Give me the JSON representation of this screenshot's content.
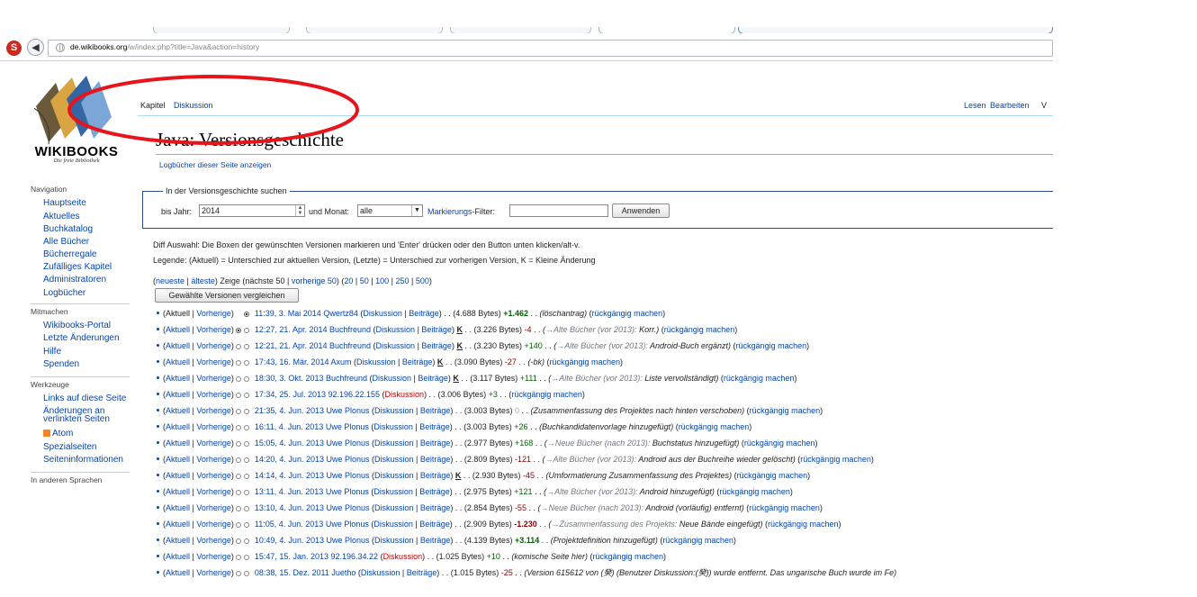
{
  "browser": {
    "url_domain": "de.wikibooks.org",
    "url_path": "/w/index.php?title=Java&action=history"
  },
  "logo": {
    "name": "WIKIBOOKS",
    "tagline": "Die freie Bibliothek"
  },
  "tabs": {
    "left": [
      "Kapitel",
      "Diskussion"
    ],
    "right": [
      "Lesen",
      "Bearbeiten",
      "V"
    ]
  },
  "page": {
    "title": "Java: Versionsgeschichte",
    "log_link": "Logbücher dieser Seite anzeigen"
  },
  "nav": {
    "navigation_title": "Navigation",
    "navigation_items": [
      "Hauptseite",
      "Aktuelles",
      "Buchkatalog",
      "Alle Bücher",
      "Bücherregale",
      "Zufälliges Kapitel",
      "Administratoren",
      "Logbücher"
    ],
    "mitmachen_title": "Mitmachen",
    "mitmachen_items": [
      "Wikibooks-Portal",
      "Letzte Änderungen",
      "Hilfe",
      "Spenden"
    ],
    "werkzeuge_title": "Werkzeuge",
    "werkzeuge_items": [
      "Links auf diese Seite",
      "Änderungen an",
      "verlinkten Seiten",
      "Atom",
      "Spezialseiten",
      "Seiteninformationen"
    ],
    "languages_title": "In anderen Sprachen"
  },
  "search": {
    "legend": "In der Versionsgeschichte suchen",
    "year_label": "bis Jahr:",
    "year_value": "2014",
    "month_label": "und Monat:",
    "month_value": "alle",
    "filter_label": "Markierungs",
    "filter_suffix": "-Filter:",
    "apply_button": "Anwenden"
  },
  "info": {
    "diff_help": "Diff Auswahl: Die Boxen der gewünschten Versionen markieren und 'Enter' drücken oder den Button unten klicken/alt-v.",
    "legend": "Legende: (Aktuell) = Unterschied zur aktuellen Version, (Letzte) = Unterschied zur vorherigen Version, K = Kleine Änderung"
  },
  "paging": {
    "newest": "neueste",
    "oldest": "älteste",
    "show": "Zeige (nächste 50 |",
    "prev50": "vorherige 50",
    "sizes": [
      "20",
      "50",
      "100",
      "250",
      "500"
    ],
    "compare_button": "Gewählte Versionen vergleichen"
  },
  "labels": {
    "current": "Aktuell",
    "previous": "Vorherige",
    "talk": "Diskussion",
    "contribs": "Beiträge",
    "undo": "rückgängig machen",
    "minor": "K"
  },
  "revisions": [
    {
      "ts": "11:39, 3. Mai 2014",
      "user": "Qwertz84",
      "ip": false,
      "minor": false,
      "size": "4.688 Bytes",
      "diff": "+1.462",
      "diff_class": "pos b",
      "section": "",
      "summary": "löschantrag",
      "radio1": "gap",
      "radio2": "on",
      "current_link": false
    },
    {
      "ts": "12:27, 21. Apr. 2014",
      "user": "Buchfreund",
      "ip": false,
      "minor": true,
      "size": "3.226 Bytes",
      "diff": "-4",
      "diff_class": "neg",
      "section": "→Alte Bücher (vor 2013):",
      "summary": "Korr.",
      "radio1": "on",
      "radio2": "off",
      "current_link": true
    },
    {
      "ts": "12:21, 21. Apr. 2014",
      "user": "Buchfreund",
      "ip": false,
      "minor": true,
      "size": "3.230 Bytes",
      "diff": "+140",
      "diff_class": "pos",
      "section": "→Alte Bücher (vor 2013):",
      "summary": "Android-Buch ergänzt",
      "radio1": "off",
      "radio2": "off",
      "current_link": true
    },
    {
      "ts": "17:43, 16. Mär. 2014",
      "user": "Axum",
      "ip": false,
      "minor": true,
      "size": "3.090 Bytes",
      "diff": "-27",
      "diff_class": "neg",
      "section": "",
      "summary": "-bk",
      "radio1": "off",
      "radio2": "off",
      "current_link": true
    },
    {
      "ts": "18:30, 3. Okt. 2013",
      "user": "Buchfreund",
      "ip": false,
      "minor": true,
      "size": "3.117 Bytes",
      "diff": "+111",
      "diff_class": "pos",
      "section": "→Alte Bücher (vor 2013):",
      "summary": "Liste vervollständigt",
      "radio1": "off",
      "radio2": "off",
      "current_link": true
    },
    {
      "ts": "17:34, 25. Jul. 2013",
      "user": "92.196.22.155",
      "ip": true,
      "minor": false,
      "size": "3.006 Bytes",
      "diff": "+3",
      "diff_class": "pos",
      "section": "",
      "summary": "",
      "radio1": "off",
      "radio2": "off",
      "current_link": true
    },
    {
      "ts": "21:35, 4. Jun. 2013",
      "user": "Uwe Plonus",
      "ip": false,
      "minor": false,
      "size": "3.003 Bytes",
      "diff": "0",
      "diff_class": "zero",
      "section": "",
      "summary": "Zusammenfassung des Projektes nach hinten verschoben",
      "radio1": "off",
      "radio2": "off",
      "current_link": true
    },
    {
      "ts": "16:11, 4. Jun. 2013",
      "user": "Uwe Plonus",
      "ip": false,
      "minor": false,
      "size": "3.003 Bytes",
      "diff": "+26",
      "diff_class": "pos",
      "section": "",
      "summary": "Buchkandidatenvorlage hinzugefügt",
      "radio1": "off",
      "radio2": "off",
      "current_link": true
    },
    {
      "ts": "15:05, 4. Jun. 2013",
      "user": "Uwe Plonus",
      "ip": false,
      "minor": false,
      "size": "2.977 Bytes",
      "diff": "+168",
      "diff_class": "pos",
      "section": "→Neue Bücher (nach 2013):",
      "summary": "Buchstatus hinzugefügt",
      "radio1": "off",
      "radio2": "off",
      "current_link": true
    },
    {
      "ts": "14:20, 4. Jun. 2013",
      "user": "Uwe Plonus",
      "ip": false,
      "minor": false,
      "size": "2.809 Bytes",
      "diff": "-121",
      "diff_class": "neg",
      "section": "→Alte Bücher (vor 2013):",
      "summary": "Android aus der Buchreihe wieder gelöscht",
      "radio1": "off",
      "radio2": "off",
      "current_link": true
    },
    {
      "ts": "14:14, 4. Jun. 2013",
      "user": "Uwe Plonus",
      "ip": false,
      "minor": true,
      "size": "2.930 Bytes",
      "diff": "-45",
      "diff_class": "neg",
      "section": "",
      "summary": "Umformatierung Zusammenfassung des Projektes",
      "radio1": "off",
      "radio2": "off",
      "current_link": true
    },
    {
      "ts": "13:11, 4. Jun. 2013",
      "user": "Uwe Plonus",
      "ip": false,
      "minor": false,
      "size": "2.975 Bytes",
      "diff": "+121",
      "diff_class": "pos",
      "section": "→Alte Bücher (vor 2013):",
      "summary": "Android hinzugefügt",
      "radio1": "off",
      "radio2": "off",
      "current_link": true
    },
    {
      "ts": "13:10, 4. Jun. 2013",
      "user": "Uwe Plonus",
      "ip": false,
      "minor": false,
      "size": "2.854 Bytes",
      "diff": "-55",
      "diff_class": "neg",
      "section": "→Neue Bücher (nach 2013):",
      "summary": "Android (vorläufig) entfernt",
      "radio1": "off",
      "radio2": "off",
      "current_link": true
    },
    {
      "ts": "11:05, 4. Jun. 2013",
      "user": "Uwe Plonus",
      "ip": false,
      "minor": false,
      "size": "2.909 Bytes",
      "diff": "-1.230",
      "diff_class": "neg b",
      "section": "→Zusammenfassung des Projekts:",
      "summary": "Neue Bände eingefügt",
      "radio1": "off",
      "radio2": "off",
      "current_link": true
    },
    {
      "ts": "10:49, 4. Jun. 2013",
      "user": "Uwe Plonus",
      "ip": false,
      "minor": false,
      "size": "4.139 Bytes",
      "diff": "+3.114",
      "diff_class": "pos b",
      "section": "",
      "summary": "Projektdefinition hinzugefügt",
      "radio1": "off",
      "radio2": "off",
      "current_link": true
    },
    {
      "ts": "15:47, 15. Jan. 2013",
      "user": "92.196.34.22",
      "ip": true,
      "minor": false,
      "size": "1.025 Bytes",
      "diff": "+10",
      "diff_class": "pos",
      "section": "",
      "summary": "komische Seite hier",
      "radio1": "off",
      "radio2": "off",
      "current_link": true
    },
    {
      "ts": "08:38, 15. Dez. 2011",
      "user": "Juetho",
      "ip": false,
      "minor": false,
      "size": "1.015 Bytes",
      "diff": "-25",
      "diff_class": "neg",
      "section": "",
      "summary": "Version 615612 von (癸) (Benutzer Diskussion:(癸)) wurde entfernt. Das ungarische Buch wurde im Fe",
      "radio1": "off",
      "radio2": "off",
      "current_link": true
    }
  ]
}
